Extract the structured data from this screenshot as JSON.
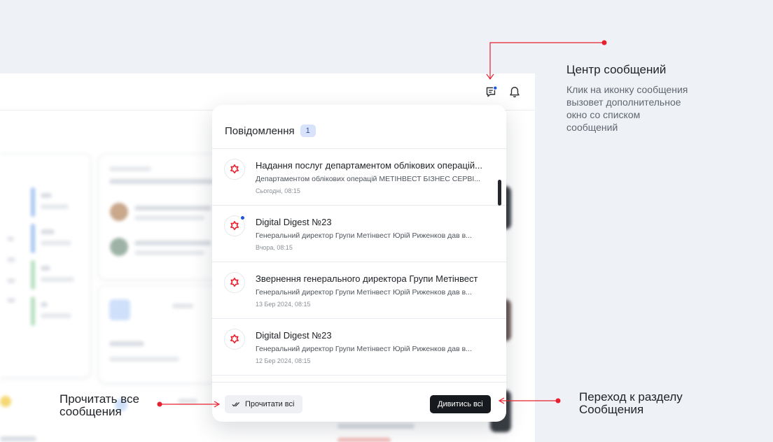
{
  "popup": {
    "title": "Повідомлення",
    "count": "1",
    "messages": [
      {
        "title": "Надання послуг департаментом облікових операцій...",
        "body": "Департаментом облікових операцій МЕТІНВЕСТ БІЗНЕС СЕРВІ...",
        "date": "Сьогодні, 08:15",
        "unread": false
      },
      {
        "title": "Digital Digest №23",
        "body": "Генеральний директор Групи Метінвест Юрій Риженков дав в...",
        "date": "Вчора, 08:15",
        "unread": true
      },
      {
        "title": "Звернення генерального директора Групи Метінвест",
        "body": "Генеральний директор Групи Метінвест Юрій Риженков дав в...",
        "date": "13 Бер 2024, 08:15",
        "unread": false
      },
      {
        "title": "Digital Digest №23",
        "body": "Генеральний директор Групи Метінвест Юрій Риженков дав в...",
        "date": "12 Бер 2024, 08:15",
        "unread": false
      }
    ],
    "read_all_label": "Прочитати всі",
    "view_all_label": "Дивитись всі"
  },
  "header": {
    "icons": [
      "message-center-icon",
      "bell-icon"
    ]
  },
  "annotations": {
    "message_center": {
      "title": "Центр сообщений",
      "description": [
        "Клик на иконку сообщения",
        "вызовет дополнительное",
        "окно со списком",
        "сообщений"
      ]
    },
    "read_all": {
      "lines": [
        "Прочитать все",
        "сообщения"
      ]
    },
    "go_to_section": {
      "lines": [
        "Переход к разделу",
        "Сообщения"
      ]
    }
  },
  "colors": {
    "accent_red": "#e8202e",
    "unread_blue": "#1d55e0",
    "dark_button": "#16191d",
    "badge_bg": "#d8e3fb"
  }
}
